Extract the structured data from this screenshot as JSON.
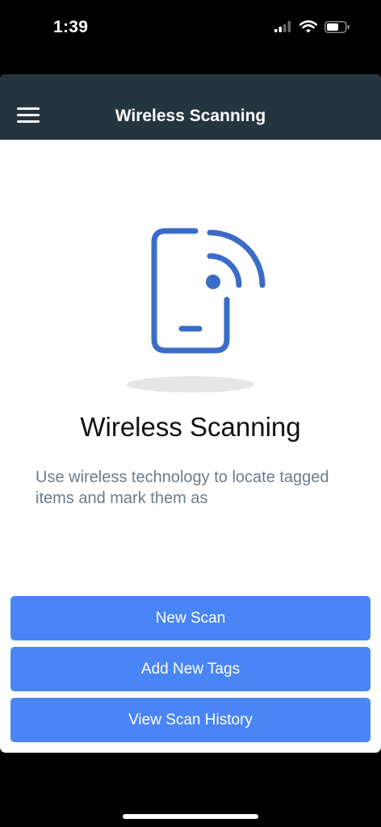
{
  "status_bar": {
    "time": "1:39",
    "icons": [
      "cellular-signal-icon",
      "wifi-icon",
      "battery-icon"
    ]
  },
  "header": {
    "title": "Wireless Scanning",
    "menu_icon": "hamburger-menu-icon"
  },
  "hero": {
    "icon": "wireless-phone-icon",
    "accent_color": "#3b6cc7"
  },
  "main": {
    "title": "Wireless Scanning",
    "description": "Use wireless technology to locate tagged items and mark them as"
  },
  "actions": {
    "new_scan": "New Scan",
    "add_new_tags": "Add New Tags",
    "view_scan_history": "View Scan History"
  },
  "colors": {
    "header_bg": "#253540",
    "button_bg": "#4a85f5",
    "description_text": "#6c7c8a"
  }
}
